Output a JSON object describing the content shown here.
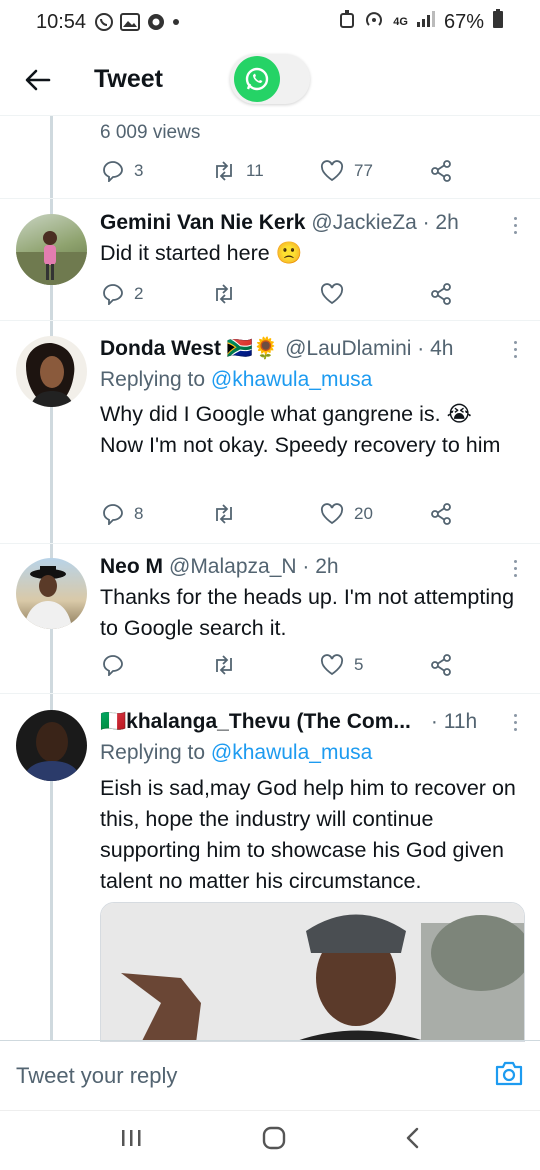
{
  "status_bar": {
    "time": "10:54",
    "network": "4G",
    "battery": "67%",
    "icons": [
      "whatsapp-icon",
      "gallery-icon",
      "chrome-icon",
      "notification-dot",
      "alarm-icon",
      "hotspot-icon",
      "signal-icon",
      "battery-icon"
    ]
  },
  "header": {
    "title": "Tweet",
    "back_icon": "arrow-left-icon",
    "floating_button_icon": "whatsapp-icon"
  },
  "main_tweet": {
    "views": "6 009 views",
    "replies": "3",
    "retweets": "11",
    "likes": "77"
  },
  "replies": [
    {
      "name": "Gemini Van Nie Kerk",
      "handle": "@JackieZa · 2h",
      "text": "Did it started here 🙁",
      "reply_count": "2",
      "retweet_count": "",
      "like_count": ""
    },
    {
      "name": "Donda West 🇿🇦🌻",
      "handle": "@LauDlamini · 4h",
      "replying_prefix": "Replying to",
      "replying_to": "@khawula_musa",
      "text": "Why did I Google what gangrene is. 😭 Now I'm not okay. Speedy recovery to him",
      "reply_count": "8",
      "retweet_count": "",
      "like_count": "20"
    },
    {
      "name": "Neo M",
      "handle": "@Malapza_N · 2h",
      "text": "Thanks for the heads up. I'm not attempting to Google search it.",
      "reply_count": "",
      "retweet_count": "",
      "like_count": "5"
    },
    {
      "name": "🇮🇹khalanga_Thevu (The Com...",
      "handle": "· 11h",
      "replying_prefix": "Replying to",
      "replying_to": "@khawula_musa",
      "text": "Eish is sad,may God help him to recover on this, hope the industry will continue supporting him to showcase his God given talent no matter his circumstance."
    }
  ],
  "reply_bar": {
    "placeholder": "Tweet your reply",
    "camera_icon": "camera-icon"
  },
  "nav_bar": {
    "icons": [
      "recent-apps-icon",
      "home-icon",
      "back-icon"
    ]
  },
  "colors": {
    "accent": "#1d9bf0",
    "whatsapp": "#25d366",
    "secondary_text": "#536471"
  }
}
